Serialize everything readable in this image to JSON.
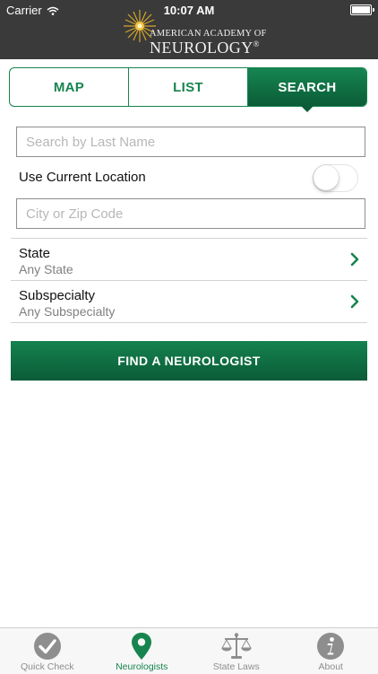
{
  "status_bar": {
    "carrier": "Carrier",
    "time": "10:07 AM"
  },
  "header": {
    "logo_line1": "AMERICAN ACADEMY OF",
    "logo_line2": "NEUROLOGY",
    "logo_mark": "®"
  },
  "segments": [
    {
      "label": "MAP",
      "active": false
    },
    {
      "label": "LIST",
      "active": false
    },
    {
      "label": "SEARCH",
      "active": true
    }
  ],
  "form": {
    "last_name_placeholder": "Search by Last Name",
    "use_location_label": "Use Current Location",
    "use_location_on": false,
    "city_placeholder": "City or Zip Code",
    "state": {
      "title": "State",
      "value": "Any State"
    },
    "subspecialty": {
      "title": "Subspecialty",
      "value": "Any Subspecialty"
    },
    "find_button": "FIND A NEUROLOGIST"
  },
  "tabbar": [
    {
      "label": "Quick Check",
      "icon": "checkmark-icon",
      "active": false
    },
    {
      "label": "Neurologists",
      "icon": "map-pin-icon",
      "active": true
    },
    {
      "label": "State Laws",
      "icon": "scales-icon",
      "active": false
    },
    {
      "label": "About",
      "icon": "info-icon",
      "active": false
    }
  ],
  "colors": {
    "brand_green": "#17844f",
    "header_bg": "#3a3a3a",
    "inactive_gray": "#8e8e8e"
  }
}
